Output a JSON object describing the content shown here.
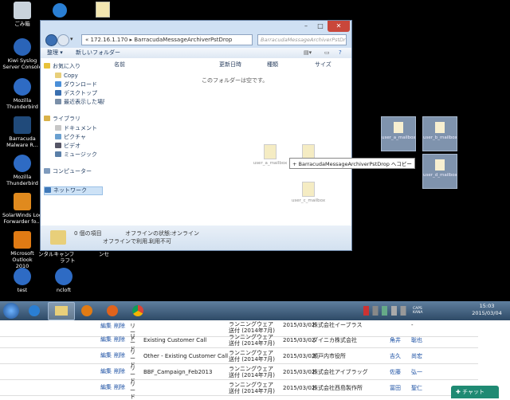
{
  "desktop": {
    "icons": [
      {
        "label": "ごみ箱",
        "icon": "recycle-bin-icon",
        "color": "#c9d3dc"
      },
      {
        "label": "Kiwi Syslog\nServer Console",
        "icon": "kiwi-icon",
        "color": "#2a64b8"
      },
      {
        "label": "Mozilla\nThunderbird",
        "icon": "thunderbird-icon",
        "color": "#2e6bc4"
      },
      {
        "label": "Barracuda\nMalware R...",
        "icon": "barracuda-icon",
        "color": "#204a7a"
      },
      {
        "label": "Mozilla\nThunderbird",
        "icon": "thunderbird-icon",
        "color": "#2e6bc4"
      },
      {
        "label": "SolarWinds Log\nForwarder fo...",
        "icon": "solarwinds-icon",
        "color": "#e08a1e"
      },
      {
        "label": "Microsoft Outlook\n2010",
        "icon": "outlook-icon",
        "color": "#e07b14"
      },
      {
        "label": "test",
        "icon": "thunderbird-icon",
        "color": "#2e6bc4"
      },
      {
        "label": "ncloft",
        "icon": "thunderbird-icon",
        "color": "#2e6bc4"
      }
    ],
    "behind_labels": [
      "ンタルキャンフ",
      "ラフト",
      "ンセ"
    ],
    "right_files": [
      "user_a_mailbox",
      "user_b_mailbox",
      "user_d_mailbox"
    ]
  },
  "explorer": {
    "address_prefix": "«",
    "address": "172.16.1.170 ▸ BarracudaMessageArchiverPstDrop",
    "search_placeholder": "BarracudaMessageArchiverPstDrop の検索",
    "toolbar": {
      "organize": "整理 ▾",
      "new_folder": "新しいフォルダー"
    },
    "nav": {
      "favorites": "お気に入り",
      "fav_items": [
        "Copy",
        "ダウンロード",
        "デスクトップ",
        "最近表示した場所"
      ],
      "libraries": "ライブラリ",
      "lib_items": [
        "ドキュメント",
        "ピクチャ",
        "ビデオ",
        "ミュージック"
      ],
      "computer": "コンピューター",
      "network": "ネットワーク"
    },
    "columns": {
      "name": "名前",
      "modified": "更新日時",
      "type": "種類",
      "size": "サイズ"
    },
    "empty_text": "このフォルダーは空です。",
    "drag_files": [
      "user_a_mailbox",
      "user_b_mailbox",
      "user_c_mailbox"
    ],
    "drag_tooltip": "+ BarracudaMessageArchiverPstDrop へコピー",
    "status": {
      "count": "0 個の項目",
      "offline_label": "オフラインの状態:",
      "offline_value": "オンライン",
      "avail_label": "オフラインで利用...",
      "avail_value": "利用不可"
    }
  },
  "taskbar": {
    "lang": "CAPS KANA",
    "time": "15:03",
    "date": "2015/03/04"
  },
  "table": {
    "rows": [
      {
        "edit": "編集",
        "del": "削除",
        "type": "リード",
        "name": "",
        "date_label": "ランニングウェア送付 (2014年7月)",
        "date": "2015/03/02",
        "company": "株式会社イーブラス",
        "last": "",
        "first": "-"
      },
      {
        "edit": "編集",
        "del": "削除",
        "type": "リード",
        "name": "Existing Customer Call",
        "date_label": "ランニングウェア送付 (2014年7月)",
        "date": "2015/03/02",
        "company": "ダイニカ株式会社",
        "last": "角井",
        "first": "聡也"
      },
      {
        "edit": "編集",
        "del": "削除",
        "type": "リード",
        "name": "Other - Existing Customer Call",
        "date_label": "ランニングウェア送付 (2014年7月)",
        "date": "2015/03/02",
        "company": "瀬戸内市役所",
        "last": "吉久",
        "first": "尚宏"
      },
      {
        "edit": "編集",
        "del": "削除",
        "type": "リード",
        "name": "BBF_Campaign_Feb2013",
        "date_label": "ランニングウェア送付 (2014年7月)",
        "date": "2015/03/02",
        "company": "株式会社アイブラッグ",
        "last": "佐藤",
        "first": "弘一"
      },
      {
        "edit": "編集",
        "del": "削除",
        "type": "リード",
        "name": "",
        "date_label": "ランニングウェア送付 (2014年7月)",
        "date": "2015/03/02",
        "company": "株式会社西島製作所",
        "last": "冨田",
        "first": "聖仁"
      }
    ]
  },
  "chat": {
    "label": "チャット"
  }
}
